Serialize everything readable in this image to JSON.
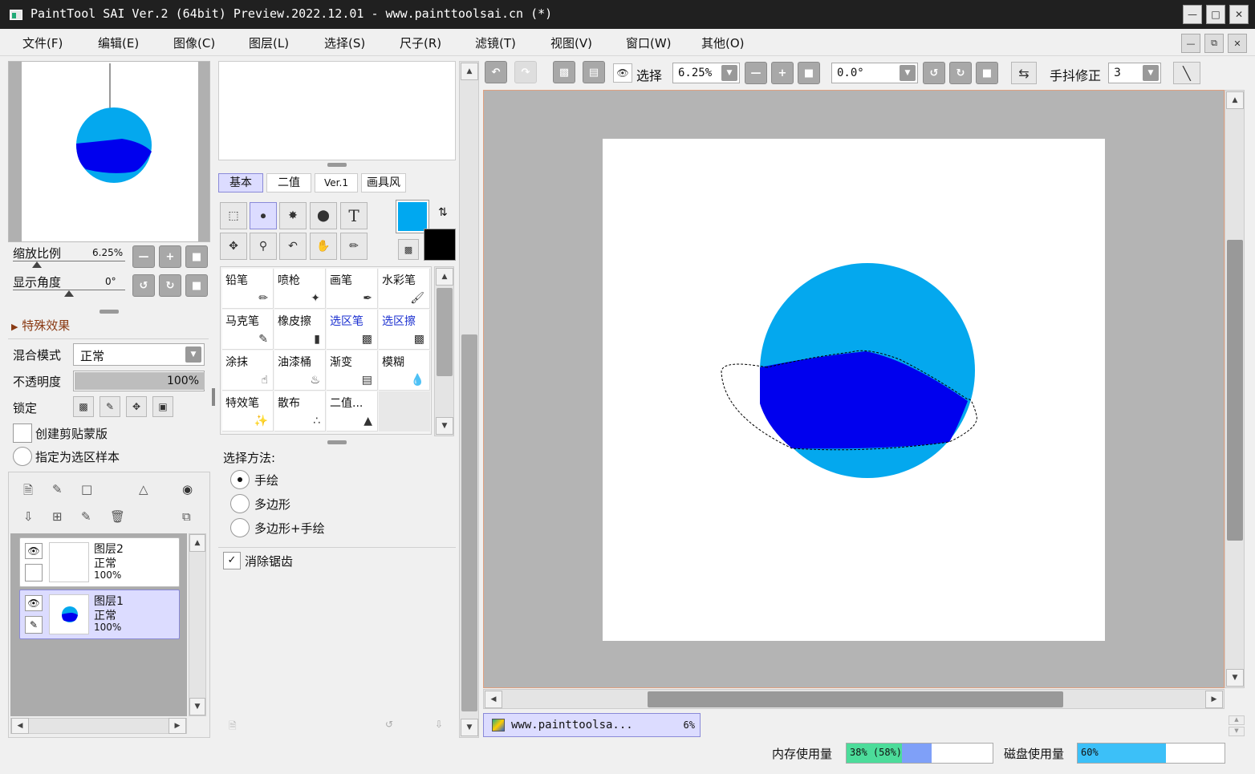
{
  "window": {
    "title": "PaintTool SAI Ver.2 (64bit) Preview.2022.12.01 - www.painttoolsai.cn (*)"
  },
  "menu": [
    "文件(F)",
    "编辑(E)",
    "图像(C)",
    "图层(L)",
    "选择(S)",
    "尺子(R)",
    "滤镜(T)",
    "视图(V)",
    "窗口(W)",
    "其他(O)"
  ],
  "navigator": {
    "zoom_label": "缩放比例",
    "zoom_value": "6.25%",
    "angle_label": "显示角度",
    "angle_value": "0°"
  },
  "layer_props": {
    "special_effects": "特殊效果",
    "blend_label": "混合模式",
    "blend_value": "正常",
    "opacity_label": "不透明度",
    "opacity_value": "100%",
    "opacity": 1.0,
    "lock_label": "锁定",
    "clipping_label": "创建剪贴蒙版",
    "selection_source_label": "指定为选区样本"
  },
  "layers": [
    {
      "name": "图层2",
      "mode": "正常",
      "opacity": "100%"
    },
    {
      "name": "图层1",
      "mode": "正常",
      "opacity": "100%"
    }
  ],
  "tool_tabs": [
    "基本",
    "二值",
    "Ver.1",
    "画具风"
  ],
  "colors": {
    "primary": "#00a8f0",
    "secondary": "#000000",
    "canvas_bg": "#b4b4b4",
    "circle_light": "#04a8ee",
    "circle_dark": "#0000ee"
  },
  "brushes": [
    {
      "label": "铅笔",
      "blue": false
    },
    {
      "label": "喷枪",
      "blue": false
    },
    {
      "label": "画笔",
      "blue": false
    },
    {
      "label": "水彩笔",
      "blue": false
    },
    {
      "label": "马克笔",
      "blue": false
    },
    {
      "label": "橡皮擦",
      "blue": false
    },
    {
      "label": "选区笔",
      "blue": true
    },
    {
      "label": "选区擦",
      "blue": true
    },
    {
      "label": "涂抹",
      "blue": false
    },
    {
      "label": "油漆桶",
      "blue": false
    },
    {
      "label": "渐变",
      "blue": false
    },
    {
      "label": "模糊",
      "blue": false
    },
    {
      "label": "特效笔",
      "blue": false
    },
    {
      "label": "散布",
      "blue": false
    },
    {
      "label": "二值...",
      "blue": false
    }
  ],
  "selection_method": {
    "title": "选择方法:",
    "options": [
      "手绘",
      "多边形",
      "多边形+手绘"
    ],
    "selected": 0
  },
  "antialias": {
    "label": "消除锯齿",
    "checked": true
  },
  "toolbar": {
    "select_label": "选择",
    "zoom_value": "6.25%",
    "angle_value": "0.0°",
    "stabilizer_label": "手抖修正",
    "stabilizer_value": "3"
  },
  "doc_tab": {
    "name": "www.painttoolsa...",
    "zoom": "6%"
  },
  "status": {
    "memory_label": "内存使用量",
    "memory_value": "38% (58%)",
    "memory_usage": 0.38,
    "memory_peak": 0.58,
    "disk_label": "磁盘使用量",
    "disk_value": "60%",
    "disk_usage": 0.6
  }
}
